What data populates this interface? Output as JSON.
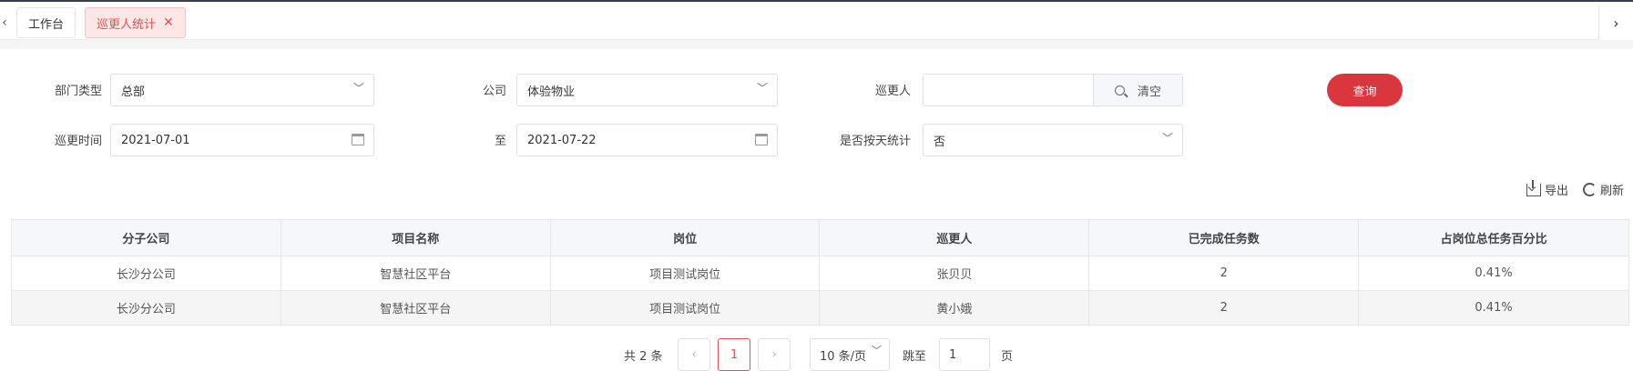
{
  "tabs": [
    {
      "label": "工作台"
    },
    {
      "label": "巡更人统计"
    }
  ],
  "filters": {
    "dept_type_label": "部门类型",
    "dept_type_value": "总部",
    "company_label": "公司",
    "company_value": "体验物业",
    "patroller_label": "巡更人",
    "patroller_value": "",
    "clear_label": "清空",
    "query_label": "查询",
    "time_label": "巡更时间",
    "date_from": "2021-07-01",
    "to_label": "至",
    "date_to": "2021-07-22",
    "by_day_label": "是否按天统计",
    "by_day_value": "否"
  },
  "toolbar": {
    "export_label": "导出",
    "refresh_label": "刷新"
  },
  "table": {
    "columns": [
      "分子公司",
      "项目名称",
      "岗位",
      "巡更人",
      "已完成任务数",
      "占岗位总任务百分比"
    ],
    "rows": [
      [
        "长沙分公司",
        "智慧社区平台",
        "项目测试岗位",
        "张贝贝",
        "2",
        "0.41%"
      ],
      [
        "长沙分公司",
        "智慧社区平台",
        "项目测试岗位",
        "黄小娥",
        "2",
        "0.41%"
      ]
    ]
  },
  "pagination": {
    "total_text": "共 2 条",
    "current_page": "1",
    "page_size": "10 条/页",
    "jump_label": "跳至",
    "jump_value": "1",
    "page_unit": "页"
  }
}
